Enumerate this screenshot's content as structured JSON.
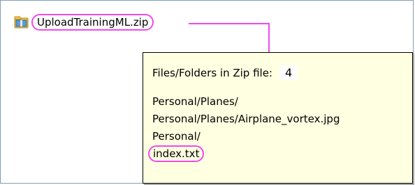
{
  "file": {
    "name": "UploadTrainingML.zip",
    "icon": "zip-folder-icon"
  },
  "tooltip": {
    "header_label": "Files/Folders in Zip file:",
    "count": "4",
    "entries": [
      "Personal/Planes/",
      "Personal/Planes/Airplane_vortex.jpg",
      "Personal/",
      "index.txt"
    ]
  },
  "colors": {
    "highlight": "#f04ae8",
    "tooltip_bg": "#ffffe1",
    "frame_border": "#7f9db9"
  }
}
